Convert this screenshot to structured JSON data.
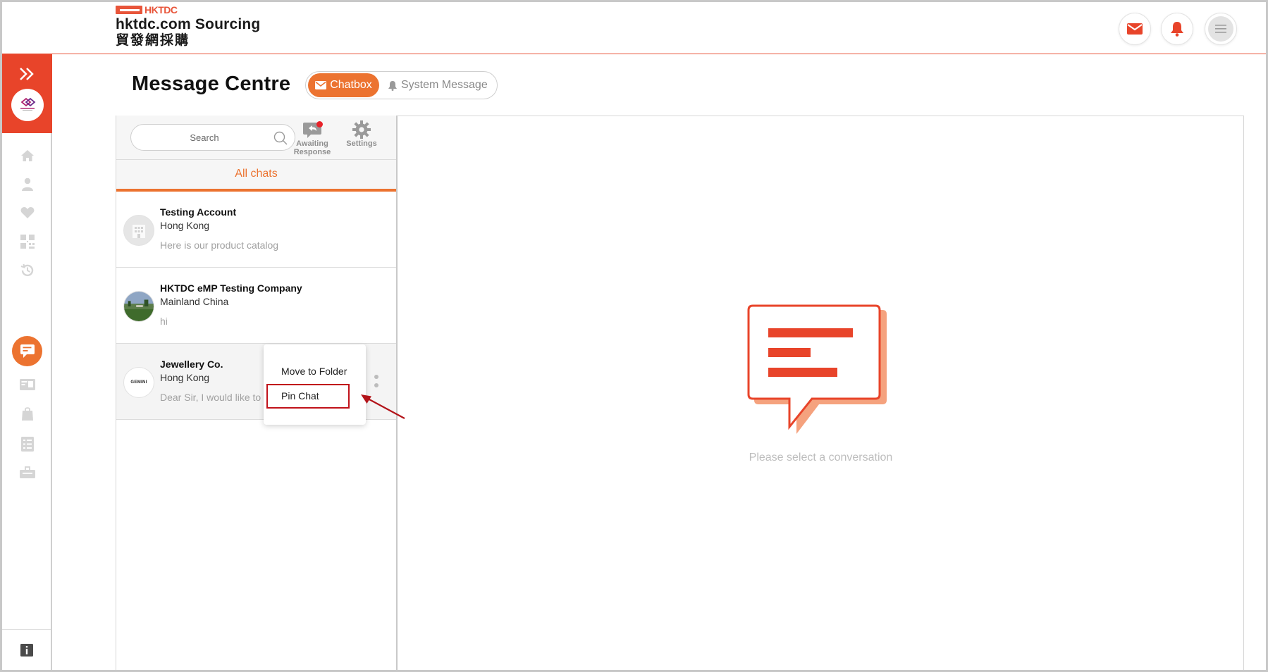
{
  "header": {
    "logo_mark": "HKTDC",
    "logo_title": "hktdc.com Sourcing",
    "logo_chinese": "貿發網採購",
    "buttons": [
      "mail-icon",
      "bell-icon",
      "menu-icon"
    ]
  },
  "sidebar": {
    "items": [
      "home-icon",
      "user-icon",
      "heart-icon",
      "qr-code-icon",
      "history-icon",
      "chat-icon",
      "card-icon",
      "bag-icon",
      "list-icon",
      "tools-icon"
    ],
    "active": "chat-icon",
    "bottom": "info-icon"
  },
  "page": {
    "title": "Message Centre",
    "tabs": {
      "chatbox": "Chatbox",
      "system": "System Message"
    }
  },
  "chatlist": {
    "search_placeholder": "Search",
    "awaiting_label_1": "Awaiting",
    "awaiting_label_2": "Response",
    "settings_label": "Settings",
    "all_chats": "All chats",
    "chats": [
      {
        "name": "Testing Account",
        "location": "Hong Kong",
        "message": "Here is our product catalog"
      },
      {
        "name": "HKTDC eMP Testing Company",
        "location": "Mainland China",
        "message": "hi"
      },
      {
        "name": "Jewellery Co.",
        "location": "Hong Kong",
        "message": "Dear Sir, I would like to k",
        "avatar_text": "GEMINI"
      }
    ]
  },
  "context_menu": {
    "move": "Move to Folder",
    "pin": "Pin Chat"
  },
  "empty_state": {
    "text": "Please select a conversation"
  },
  "colors": {
    "accent": "#ec7330",
    "brand_red": "#e8442a",
    "highlight": "#c0121a"
  }
}
